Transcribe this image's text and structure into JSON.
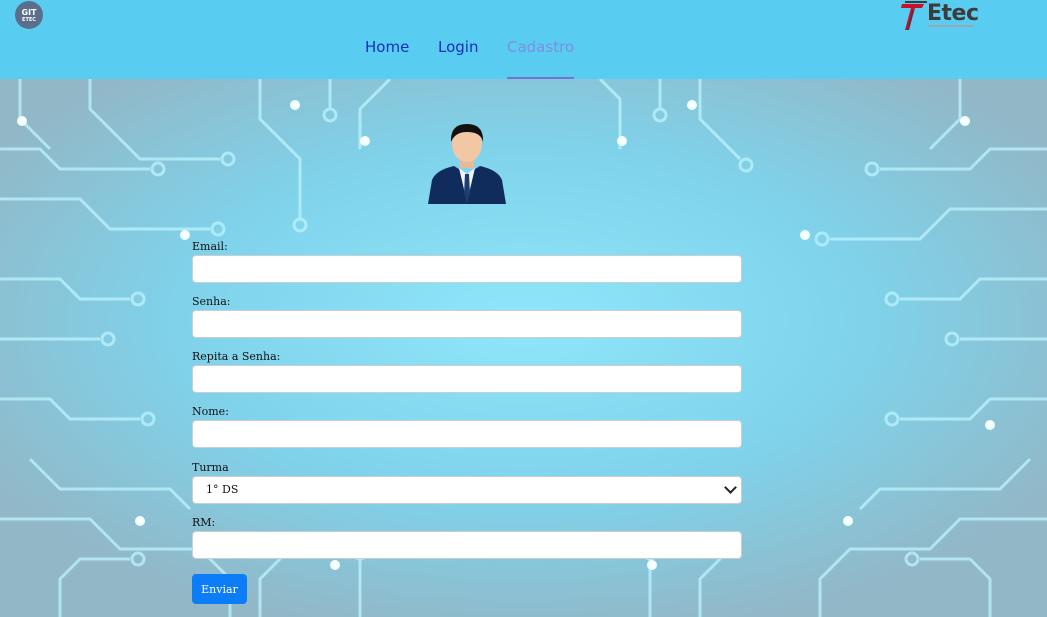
{
  "header": {
    "logo_left": {
      "line1": "GIT",
      "line2": "ETEC"
    },
    "logo_right": {
      "text": "Etec"
    },
    "nav": [
      {
        "label": "Home",
        "active": false
      },
      {
        "label": "Login",
        "active": false
      },
      {
        "label": "Cadastro",
        "active": true
      }
    ]
  },
  "form": {
    "email": {
      "label": "Email:",
      "value": ""
    },
    "senha": {
      "label": "Senha:",
      "value": ""
    },
    "repita_senha": {
      "label": "Repita a Senha:",
      "value": ""
    },
    "nome": {
      "label": "Nome:",
      "value": ""
    },
    "turma": {
      "label": "Turma",
      "selected": "1° DS"
    },
    "rm": {
      "label": "RM:",
      "value": ""
    },
    "submit_label": "Enviar"
  },
  "colors": {
    "header_bg": "#59cdf1",
    "nav_link": "#1b2fb8",
    "nav_active": "#7f8fe0",
    "button_bg": "#0d7cf7"
  },
  "icons": [
    "git-etec-logo",
    "etec-logo",
    "user-avatar-icon",
    "chevron-down-icon"
  ]
}
